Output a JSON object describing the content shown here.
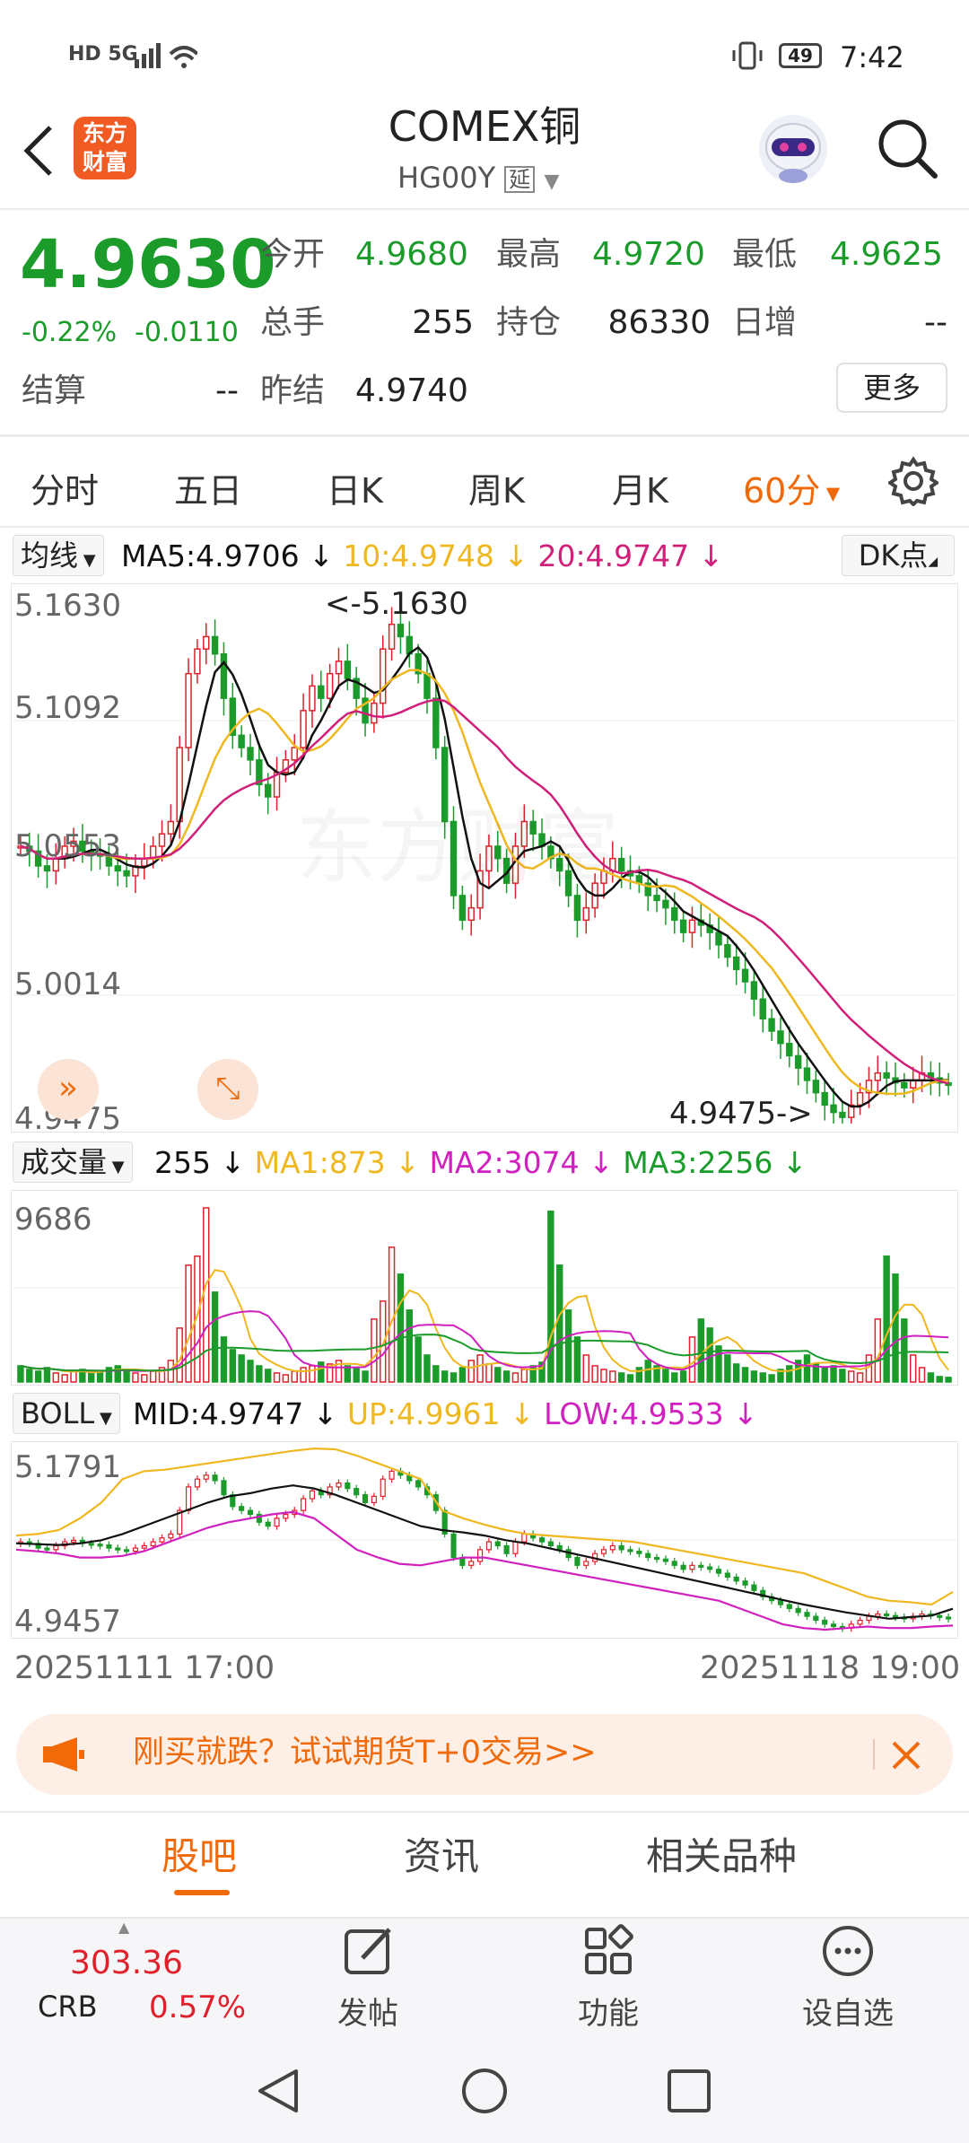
{
  "status_bar": {
    "left": "HD 5G",
    "battery": "49",
    "time": "7:42"
  },
  "header": {
    "logo_l1": "东方",
    "logo_l2": "财富",
    "title": "COMEX铜",
    "subtitle": "HG00Y",
    "delay_badge": "延"
  },
  "quote": {
    "price": "4.9630",
    "change_pct": "-0.22%",
    "change": "-0.0110",
    "open_label": "今开",
    "open": "4.9680",
    "high_label": "最高",
    "high": "4.9720",
    "low_label": "最低",
    "low": "4.9625",
    "volume_label": "总手",
    "volume": "255",
    "oi_label": "持仓",
    "oi": "86330",
    "inc_label": "日增",
    "inc": "--",
    "settle_label": "结算",
    "settle": "--",
    "prev_settle_label": "昨结",
    "prev_settle": "4.9740",
    "more": "更多"
  },
  "tabs": [
    {
      "label": "分时"
    },
    {
      "label": "五日"
    },
    {
      "label": "日K"
    },
    {
      "label": "周K"
    },
    {
      "label": "月K"
    },
    {
      "label": "60分"
    }
  ],
  "colors": {
    "up": "#e0202a",
    "down": "#1a9b2a",
    "ma5": "#111111",
    "ma10": "#f0b820",
    "ma20": "#d0207a",
    "accent": "#f06a0a"
  },
  "ma_bar": {
    "selector": "均线",
    "ma5": "MA5:4.9706",
    "ma10": "10:4.9748",
    "ma20": "20:4.9747",
    "dk": "DK点"
  },
  "vol_bar": {
    "selector": "成交量",
    "vol": "255",
    "ma1": "MA1:873",
    "ma2": "MA2:3074",
    "ma3": "MA3:2256"
  },
  "boll_bar": {
    "selector": "BOLL",
    "mid": "MID:4.9747",
    "up": "UP:4.9961",
    "low": "LOW:4.9533"
  },
  "chart_data": [
    {
      "type": "candlestick",
      "y_ticks": [
        "5.1630",
        "5.1092",
        "5.0553",
        "5.0014",
        "4.9475"
      ],
      "ylim": [
        4.9475,
        5.163
      ],
      "max_label": "<-5.1630",
      "min_label": "4.9475->",
      "watermark": "东方财富",
      "closes": [
        5.06,
        5.058,
        5.052,
        5.05,
        5.055,
        5.06,
        5.062,
        5.058,
        5.057,
        5.056,
        5.052,
        5.05,
        5.048,
        5.052,
        5.055,
        5.06,
        5.065,
        5.07,
        5.1,
        5.13,
        5.14,
        5.145,
        5.138,
        5.12,
        5.105,
        5.1,
        5.095,
        5.085,
        5.08,
        5.09,
        5.095,
        5.1,
        5.115,
        5.125,
        5.12,
        5.13,
        5.135,
        5.128,
        5.12,
        5.11,
        5.118,
        5.14,
        5.15,
        5.145,
        5.138,
        5.13,
        5.12,
        5.1,
        5.07,
        5.04,
        5.03,
        5.035,
        5.05,
        5.06,
        5.055,
        5.045,
        5.06,
        5.07,
        5.065,
        5.06,
        5.055,
        5.05,
        5.04,
        5.03,
        5.035,
        5.045,
        5.05,
        5.055,
        5.05,
        5.048,
        5.045,
        5.04,
        5.038,
        5.035,
        5.03,
        5.025,
        5.03,
        5.028,
        5.025,
        5.02,
        5.015,
        5.01,
        5.005,
        4.998,
        4.99,
        4.985,
        4.98,
        4.975,
        4.97,
        4.965,
        4.96,
        4.955,
        4.952,
        4.95,
        4.955,
        4.96,
        4.965,
        4.968,
        4.966,
        4.964,
        4.962,
        4.965,
        4.968,
        4.966,
        4.964,
        4.963
      ]
    },
    {
      "type": "bar",
      "title": "成交量",
      "y_ticks": [
        "9686"
      ],
      "ylim": [
        0,
        9686
      ],
      "values": [
        900,
        700,
        600,
        800,
        500,
        400,
        600,
        700,
        500,
        600,
        800,
        900,
        700,
        500,
        400,
        600,
        800,
        1200,
        3000,
        6500,
        7000,
        9686,
        5000,
        2500,
        1800,
        1500,
        1200,
        900,
        700,
        500,
        400,
        600,
        800,
        900,
        1100,
        1000,
        1200,
        900,
        800,
        600,
        3500,
        4500,
        7500,
        6000,
        4000,
        2500,
        1500,
        900,
        600,
        500,
        800,
        1200,
        1500,
        1000,
        800,
        600,
        500,
        700,
        900,
        1100,
        9500,
        6500,
        4000,
        2500,
        1500,
        900,
        700,
        600,
        500,
        400,
        800,
        1200,
        900,
        700,
        500,
        600,
        2500,
        3500,
        3000,
        2000,
        1500,
        1000,
        800,
        600,
        500,
        400,
        700,
        900,
        1200,
        1500,
        1000,
        800,
        900,
        700,
        600,
        500,
        1500,
        3500,
        7000,
        6000,
        3500,
        1500,
        800,
        500,
        300,
        255
      ],
      "series": [
        {
          "name": "MA1",
          "values": [
            873
          ]
        },
        {
          "name": "MA2",
          "values": [
            3074
          ]
        },
        {
          "name": "MA3",
          "values": [
            2256
          ]
        }
      ]
    },
    {
      "type": "line",
      "title": "BOLL",
      "y_ticks": [
        "5.1791",
        "4.9457"
      ],
      "ylim": [
        4.9457,
        5.1791
      ],
      "series": [
        {
          "name": "MID",
          "values": [
            5.058,
            5.057,
            5.056,
            5.058,
            5.062,
            5.07,
            5.08,
            5.09,
            5.1,
            5.11,
            5.118,
            5.122,
            5.128,
            5.132,
            5.128,
            5.12,
            5.11,
            5.1,
            5.09,
            5.08,
            5.075,
            5.072,
            5.068,
            5.062,
            5.058,
            5.052,
            5.046,
            5.04,
            5.034,
            5.028,
            5.022,
            5.016,
            5.01,
            5.004,
            4.998,
            4.992,
            4.986,
            4.98,
            4.975,
            4.97,
            4.966,
            4.962,
            4.964,
            4.966,
            4.9747
          ]
        },
        {
          "name": "UP",
          "values": [
            5.068,
            5.07,
            5.075,
            5.09,
            5.11,
            5.14,
            5.15,
            5.152,
            5.156,
            5.16,
            5.164,
            5.168,
            5.172,
            5.176,
            5.179,
            5.178,
            5.17,
            5.16,
            5.15,
            5.14,
            5.1,
            5.09,
            5.082,
            5.075,
            5.07,
            5.068,
            5.066,
            5.064,
            5.062,
            5.06,
            5.055,
            5.05,
            5.045,
            5.04,
            5.035,
            5.03,
            5.025,
            5.02,
            5.01,
            5.0,
            4.99,
            4.985,
            4.983,
            4.98,
            4.9961
          ]
        },
        {
          "name": "LOW",
          "values": [
            5.05,
            5.048,
            5.045,
            5.04,
            5.04,
            5.042,
            5.048,
            5.058,
            5.068,
            5.078,
            5.085,
            5.09,
            5.095,
            5.098,
            5.09,
            5.07,
            5.05,
            5.04,
            5.032,
            5.03,
            5.035,
            5.04,
            5.04,
            5.035,
            5.03,
            5.025,
            5.02,
            5.015,
            5.01,
            5.005,
            5.0,
            4.995,
            4.99,
            4.985,
            4.975,
            4.965,
            4.955,
            4.95,
            4.948,
            4.95,
            4.952,
            4.95,
            4.95,
            4.952,
            4.9533
          ]
        }
      ]
    }
  ],
  "date_start": "20251111 17:00",
  "date_end": "20251118 19:00",
  "banner": {
    "text": "刚买就跌？试试期货T+0交易>>"
  },
  "bottom_tabs": [
    {
      "label": "股吧"
    },
    {
      "label": "资讯"
    },
    {
      "label": "相关品种"
    }
  ],
  "bottom_nav": {
    "crb_value": "303.36",
    "crb_name": "CRB",
    "crb_pct": "0.57%",
    "post": "发帖",
    "func": "功能",
    "watch": "设自选"
  }
}
